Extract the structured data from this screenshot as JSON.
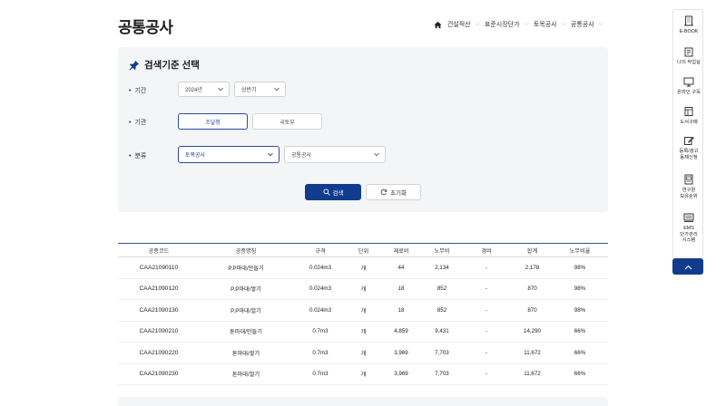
{
  "page": {
    "title": "공통공사"
  },
  "breadcrumb": {
    "items": [
      "건설적산",
      "표준시장단가",
      "토목공사",
      "공통공사"
    ]
  },
  "search": {
    "title": "검색기준 선택",
    "period": {
      "label": "기간",
      "year": "2024년",
      "half": "상반기"
    },
    "agency": {
      "label": "기관",
      "options": [
        "조달청",
        "국토부"
      ],
      "selected": "조달청"
    },
    "category": {
      "label": "분류",
      "primary": "토목공사",
      "secondary": "공통공사"
    },
    "search_button": "검색",
    "reset_button": "초기화"
  },
  "table": {
    "headers": [
      "공종코드",
      "공종명칭",
      "규격",
      "단위",
      "재료비",
      "노무비",
      "경비",
      "합계",
      "노무비율"
    ],
    "rows": [
      [
        "CAA21090110",
        "P.P마대/만들기",
        "0.024m3",
        "개",
        "44",
        "2,134",
        "-",
        "2,178",
        "98%"
      ],
      [
        "CAA21090120",
        "P.P마대/쌓기",
        "0.024m3",
        "개",
        "18",
        "852",
        "-",
        "870",
        "98%"
      ],
      [
        "CAA21090130",
        "P.P마대/헐기",
        "0.024m3",
        "개",
        "18",
        "852",
        "-",
        "870",
        "98%"
      ],
      [
        "CAA21090210",
        "톤마대/만들기",
        "0.7m3",
        "개",
        "4,859",
        "9,431",
        "-",
        "14,290",
        "66%"
      ],
      [
        "CAA21090220",
        "톤마대/쌓기",
        "0.7m3",
        "개",
        "3,969",
        "7,703",
        "-",
        "11,672",
        "66%"
      ],
      [
        "CAA21090230",
        "톤마대/헐기",
        "0.7m3",
        "개",
        "3,969",
        "7,703",
        "-",
        "11,672",
        "66%"
      ]
    ]
  },
  "side_nav": {
    "items": [
      {
        "label": "E-BOOK",
        "icon": "building-icon"
      },
      {
        "label": "나의 작업실",
        "icon": "briefcase-icon"
      },
      {
        "label": "온라인 구독",
        "icon": "monitor-icon"
      },
      {
        "label": "도서구매",
        "icon": "book-icon"
      },
      {
        "label": "등록/광고\n동제신청",
        "icon": "edit-icon"
      },
      {
        "label": "연구원\n보유순위",
        "icon": "document-icon"
      },
      {
        "label": "EMS\n단가관리\n시스템",
        "icon": "keyboard-icon"
      }
    ],
    "top_button_icon": "chevron-up-icon"
  },
  "colors": {
    "primary": "#113c8e",
    "accent_border": "#2b4aa5",
    "panel_bg": "#f4f5f7",
    "table_header_line": "#3a4f8c"
  }
}
